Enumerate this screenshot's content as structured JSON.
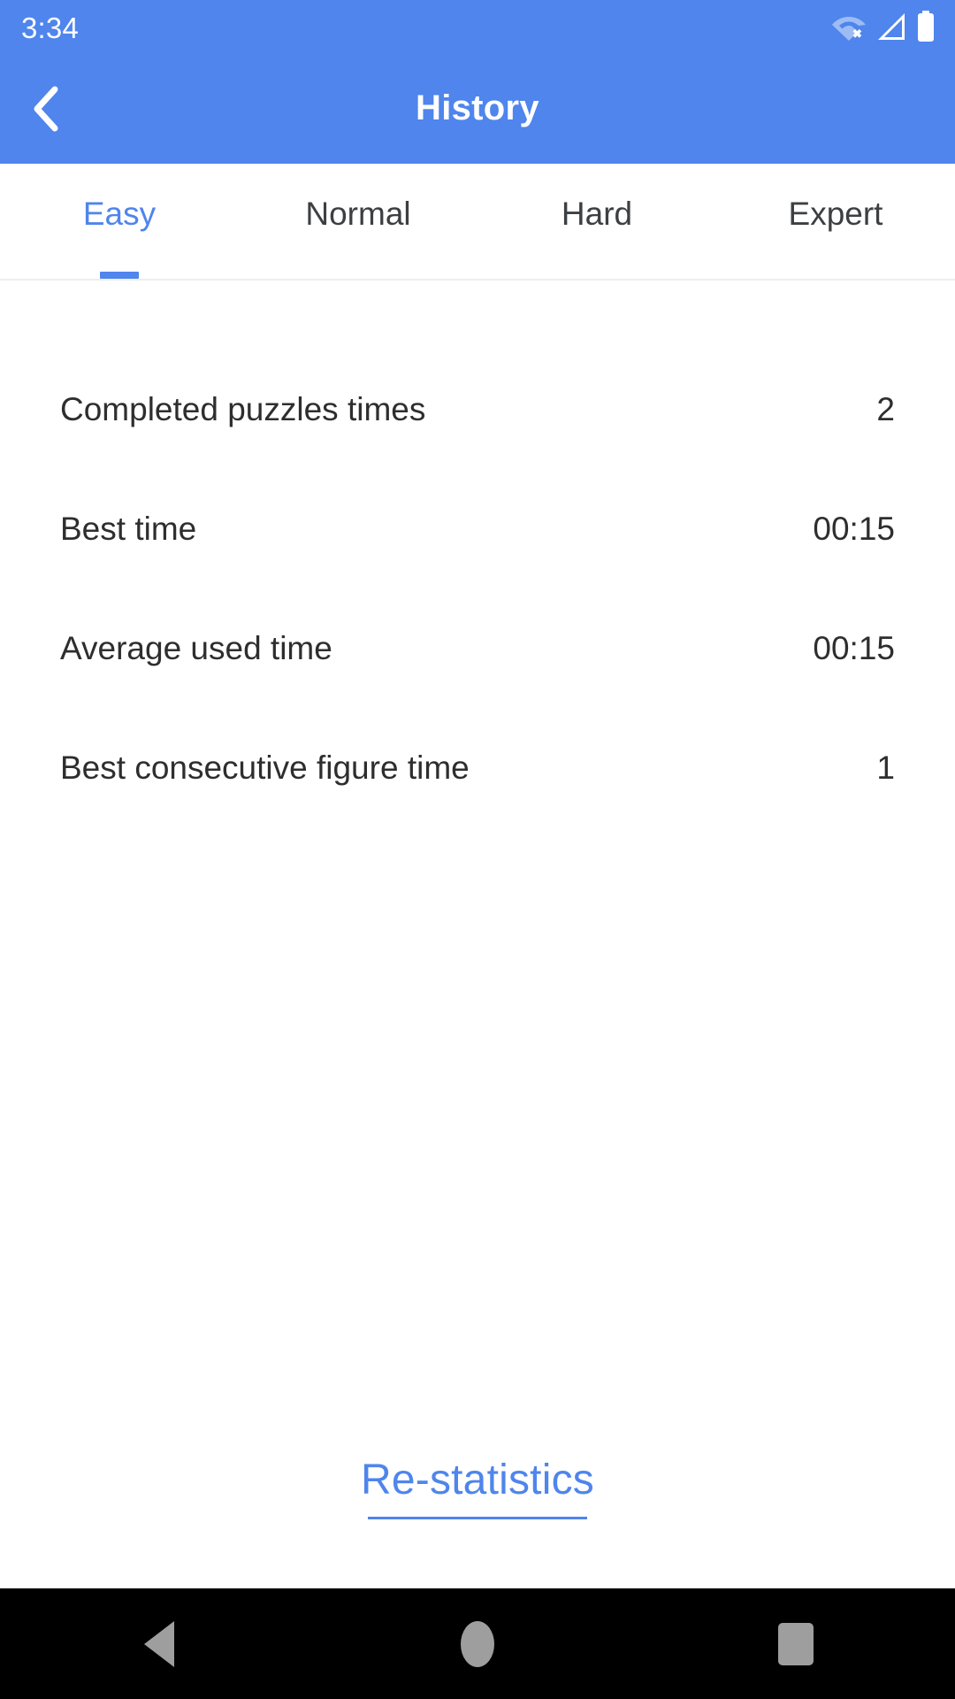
{
  "theme": {
    "brand_color": "#4F85EC",
    "text_color": "#2e2e2e",
    "nav_icon_color": "#9e9e9e",
    "divider_color": "#eceef0"
  },
  "status_bar": {
    "time": "3:34",
    "icons": [
      {
        "name": "wifi-off-icon",
        "label": "WiFi disconnected"
      },
      {
        "name": "cell-signal-icon",
        "label": "Cellular signal"
      },
      {
        "name": "battery-icon",
        "label": "Battery full"
      }
    ]
  },
  "app_bar": {
    "back_icon": "chevron-left-icon",
    "title": "History"
  },
  "tabs": [
    {
      "label": "Easy",
      "active": true
    },
    {
      "label": "Normal",
      "active": false
    },
    {
      "label": "Hard",
      "active": false
    },
    {
      "label": "Expert",
      "active": false
    }
  ],
  "stats": {
    "rows": [
      {
        "label": "Completed puzzles times",
        "value": "2"
      },
      {
        "label": "Best time",
        "value": "00:15"
      },
      {
        "label": "Average used time",
        "value": "00:15"
      },
      {
        "label": "Best consecutive figure time",
        "value": "1"
      }
    ]
  },
  "footer": {
    "restatistics_label": "Re-statistics"
  },
  "nav_bar": {
    "back_label": "Back",
    "home_label": "Home",
    "recents_label": "Recents"
  }
}
